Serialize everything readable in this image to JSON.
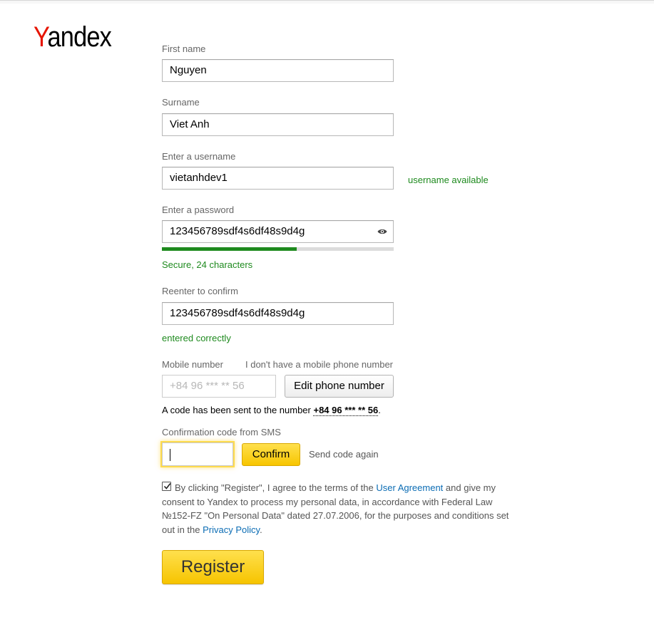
{
  "brand": {
    "logo_first": "Y",
    "logo_rest": "andex"
  },
  "form": {
    "first_name": {
      "label": "First name",
      "value": "Nguyen"
    },
    "surname": {
      "label": "Surname",
      "value": "Viet Anh"
    },
    "username": {
      "label": "Enter a username",
      "value": "vietanhdev1",
      "status": "username available"
    },
    "password": {
      "label": "Enter a password",
      "value": "123456789sdf4s6df48s9d4g",
      "strength_status": "Secure, 24 characters",
      "strength_fraction": 0.58
    },
    "confirm": {
      "label": "Reenter to confirm",
      "value": "123456789sdf4s6df48s9d4g",
      "status": "entered correctly"
    },
    "mobile": {
      "label": "Mobile number",
      "no_phone_link": "I don't have a mobile phone number",
      "placeholder": "+84 96 *** ** 56",
      "edit_button": "Edit phone number",
      "code_sent_prefix": "A code has been sent to the number ",
      "code_sent_number": "+84 96 *** ** 56",
      "code_sent_suffix": "."
    },
    "sms": {
      "label": "Confirmation code from SMS",
      "value": "",
      "confirm_button": "Confirm",
      "send_again": "Send code again"
    },
    "agreement": {
      "checked": true,
      "text_1": "By clicking \"Register\", I agree to the terms of the ",
      "link_1": "User Agreement",
      "text_2": " and give my consent to Yandex to process my personal data, in accordance with Federal Law №152-FZ \"On Personal Data\" dated 27.07.2006, for the purposes and conditions set out in the ",
      "link_2": "Privacy Policy",
      "text_3": "."
    },
    "register_button": "Register"
  },
  "colors": {
    "brand_red": "#e61400",
    "success_green": "#1e8a1e",
    "accent_yellow": "#ffdb4d",
    "link_blue": "#0b6cb4"
  },
  "icons": {
    "password_toggle": "eye-icon",
    "agreement_check": "check-icon"
  }
}
